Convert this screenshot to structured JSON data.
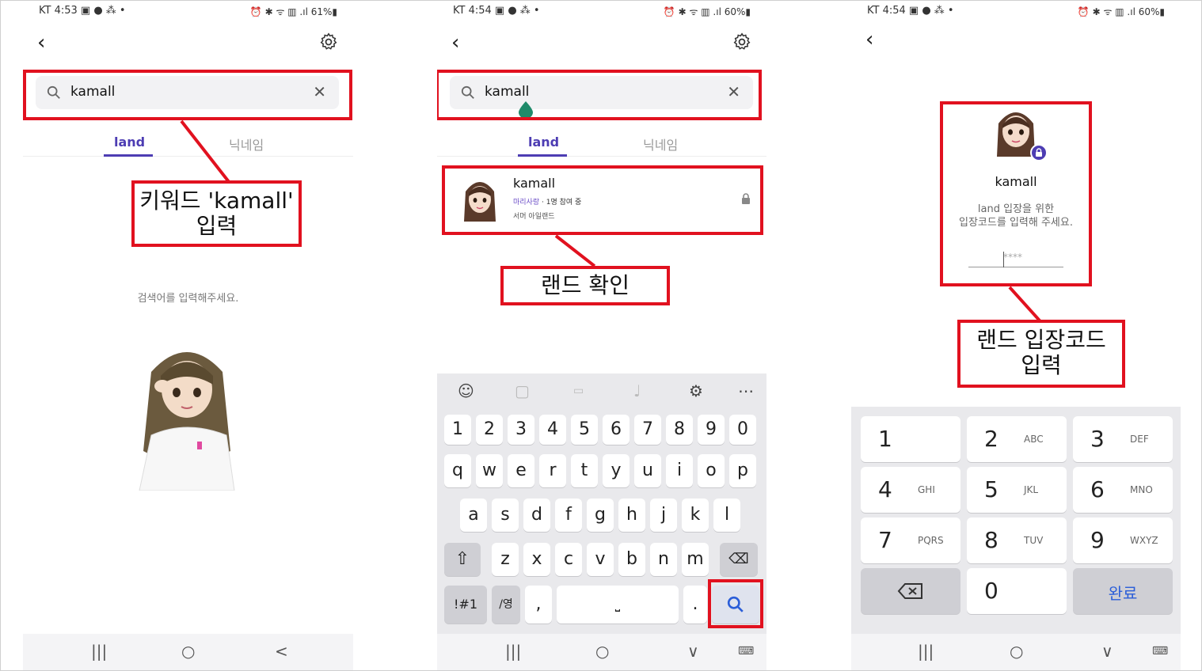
{
  "colors": {
    "accent": "#4d3db3",
    "highlight": "#e1111f",
    "search_blue": "#2b5ed8"
  },
  "screens": [
    {
      "status_left": "KT 4:53 ▣ ● ⁂ •",
      "status_right": "⏰ ✱ ᯤ ▥ .ıl 61%▮",
      "search_value": "kamall",
      "tabs": [
        "land",
        "닉네임"
      ],
      "callout": [
        "키워드 'kamall'",
        "입력"
      ],
      "empty_message": "검색어를 입력해주세요.",
      "nav": [
        "|||",
        "○",
        "<"
      ]
    },
    {
      "status_left": "KT 4:54 ▣ ● ⁂ •",
      "status_right": "⏰ ✱ ᯤ ▥ .ıl 60%▮",
      "search_value": "kamall",
      "tabs": [
        "land",
        "닉네임"
      ],
      "result": {
        "name": "kamall",
        "tag": "마리사랑",
        "members": "· 1명 참여 중",
        "sub": "서머 아일랜드"
      },
      "callout": [
        "랜드 확인"
      ],
      "keyboard": {
        "row1": [
          "1",
          "2",
          "3",
          "4",
          "5",
          "6",
          "7",
          "8",
          "9",
          "0"
        ],
        "row2": [
          "q",
          "w",
          "e",
          "r",
          "t",
          "y",
          "u",
          "i",
          "o",
          "p"
        ],
        "row3": [
          "a",
          "s",
          "d",
          "f",
          "g",
          "h",
          "j",
          "k",
          "l"
        ],
        "row4": [
          "z",
          "x",
          "c",
          "v",
          "b",
          "n",
          "m"
        ],
        "shift": "⇧",
        "backspace": "⌫",
        "symbols": "!#1",
        "lang": "/영",
        "comma": ",",
        "space": "⎵",
        "period": ".",
        "search": "🔍"
      },
      "nav": [
        "|||",
        "○",
        "∨",
        "⌨"
      ]
    },
    {
      "status_left": "KT 4:54 ▣ ● ⁂ •",
      "status_right": "⏰ ✱ ᯤ ▥ .ıl 60%▮",
      "land_name": "kamall",
      "land_desc_1": "land 입장을 위한",
      "land_desc_2": "입장코드를 입력해 주세요.",
      "code_placeholder": "****",
      "callout": [
        "랜드 입장코드",
        "입력"
      ],
      "numpad": [
        {
          "n": "1",
          "s": ""
        },
        {
          "n": "2",
          "s": "ABC"
        },
        {
          "n": "3",
          "s": "DEF"
        },
        {
          "n": "4",
          "s": "GHI"
        },
        {
          "n": "5",
          "s": "JKL"
        },
        {
          "n": "6",
          "s": "MNO"
        },
        {
          "n": "7",
          "s": "PQRS"
        },
        {
          "n": "8",
          "s": "TUV"
        },
        {
          "n": "9",
          "s": "WXYZ"
        }
      ],
      "zero": "0",
      "done": "완료",
      "nav": [
        "|||",
        "○",
        "∨",
        "⌨"
      ]
    }
  ]
}
